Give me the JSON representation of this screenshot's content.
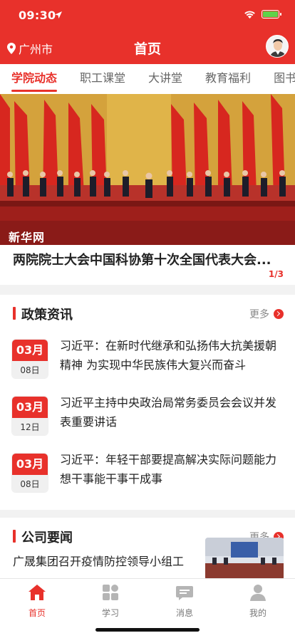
{
  "status": {
    "time": "09:30"
  },
  "header": {
    "city": "广州市",
    "title": "首页"
  },
  "tabs": [
    {
      "label": "学院动态",
      "active": true
    },
    {
      "label": "职工课堂",
      "active": false
    },
    {
      "label": "大讲堂",
      "active": false
    },
    {
      "label": "教育福利",
      "active": false
    },
    {
      "label": "图书",
      "active": false
    }
  ],
  "banner": {
    "watermark": "新华网",
    "caption": "两院院士大会中国科协第十次全国代表大会...",
    "page": "1/3"
  },
  "policy": {
    "title": "政策资讯",
    "more": "更多",
    "items": [
      {
        "month": "03月",
        "day": "08日",
        "title": "习近平：在新时代继承和弘扬伟大抗美援朝精神 为实现中华民族伟大复兴而奋斗"
      },
      {
        "month": "03月",
        "day": "12日",
        "title": "习近平主持中央政治局常务委员会会议并发表重要讲话"
      },
      {
        "month": "03月",
        "day": "08日",
        "title": "习近平：年轻干部要提高解决实际问题能力 想干事能干事干成事"
      }
    ]
  },
  "company": {
    "title": "公司要闻",
    "more": "更多",
    "first_item": "广晟集团召开疫情防控领导小组工"
  },
  "nav": [
    {
      "label": "首页",
      "icon": "home-icon",
      "active": true
    },
    {
      "label": "学习",
      "icon": "grid-icon",
      "active": false
    },
    {
      "label": "消息",
      "icon": "message-icon",
      "active": false
    },
    {
      "label": "我的",
      "icon": "user-icon",
      "active": false
    }
  ],
  "colors": {
    "accent": "#e8312b"
  }
}
